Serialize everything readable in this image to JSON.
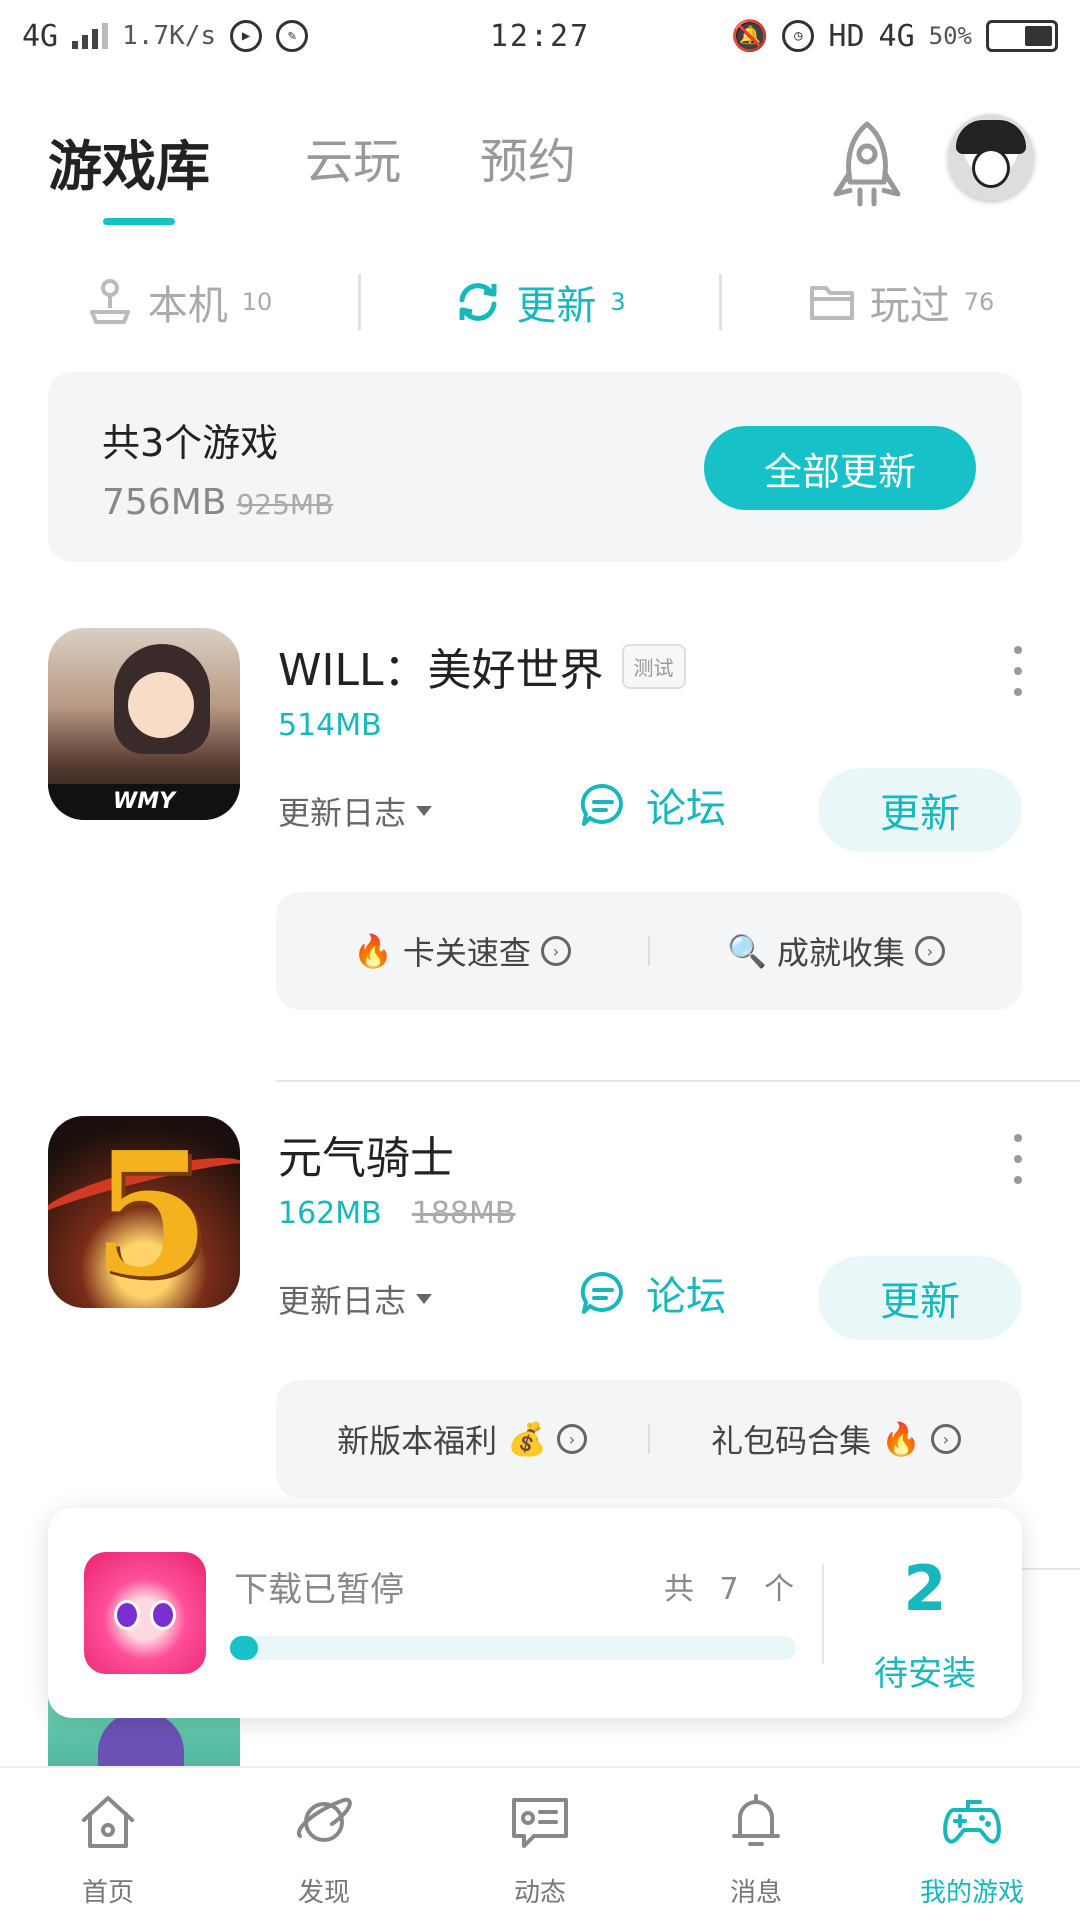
{
  "status_bar": {
    "network": "4G",
    "speed": "1.7K/s",
    "time": "12:27",
    "hd": "HD",
    "network_right": "4G",
    "battery": "50%"
  },
  "header": {
    "tabs": [
      {
        "label": "游戏库",
        "active": true
      },
      {
        "label": "云玩",
        "active": false
      },
      {
        "label": "预约",
        "active": false
      }
    ],
    "accent": "#16c2c7"
  },
  "subtabs": [
    {
      "label": "本机",
      "count": "10",
      "icon": "joystick-icon",
      "active": false
    },
    {
      "label": "更新",
      "count": "3",
      "icon": "refresh-icon",
      "active": true
    },
    {
      "label": "玩过",
      "count": "76",
      "icon": "folder-icon",
      "active": false
    }
  ],
  "summary": {
    "count_text": "共3个游戏",
    "size": "756MB",
    "old_size": "925MB",
    "update_all_label": "全部更新"
  },
  "games": [
    {
      "title": "WILL：美好世界",
      "tag": "测试",
      "size": "514MB",
      "old_size": "",
      "icon_text": "WMY",
      "changelog_label": "更新日志",
      "forum_label": "论坛",
      "update_label": "更新",
      "quick_links": [
        {
          "label": "卡关速查",
          "icon": "fire-icon"
        },
        {
          "label": "成就收集",
          "icon": "magnifier-icon"
        }
      ]
    },
    {
      "title": "元气骑士",
      "tag": "",
      "size": "162MB",
      "old_size": "188MB",
      "icon_text": "5",
      "changelog_label": "更新日志",
      "forum_label": "论坛",
      "update_label": "更新",
      "quick_links": [
        {
          "label": "新版本福利",
          "icon": "money-bag-icon"
        },
        {
          "label": "礼包码合集",
          "icon": "fire-icon"
        }
      ]
    }
  ],
  "download_panel": {
    "status": "下载已暂停",
    "total": "共 7 个",
    "progress": 0.02,
    "pending_count": "2",
    "pending_label": "待安装"
  },
  "bottom_nav": [
    {
      "label": "首页",
      "icon": "home-icon",
      "active": false
    },
    {
      "label": "发现",
      "icon": "planet-icon",
      "active": false
    },
    {
      "label": "动态",
      "icon": "chat-card-icon",
      "active": false
    },
    {
      "label": "消息",
      "icon": "bell-icon",
      "active": false
    },
    {
      "label": "我的游戏",
      "icon": "gamepad-icon",
      "active": true
    }
  ]
}
